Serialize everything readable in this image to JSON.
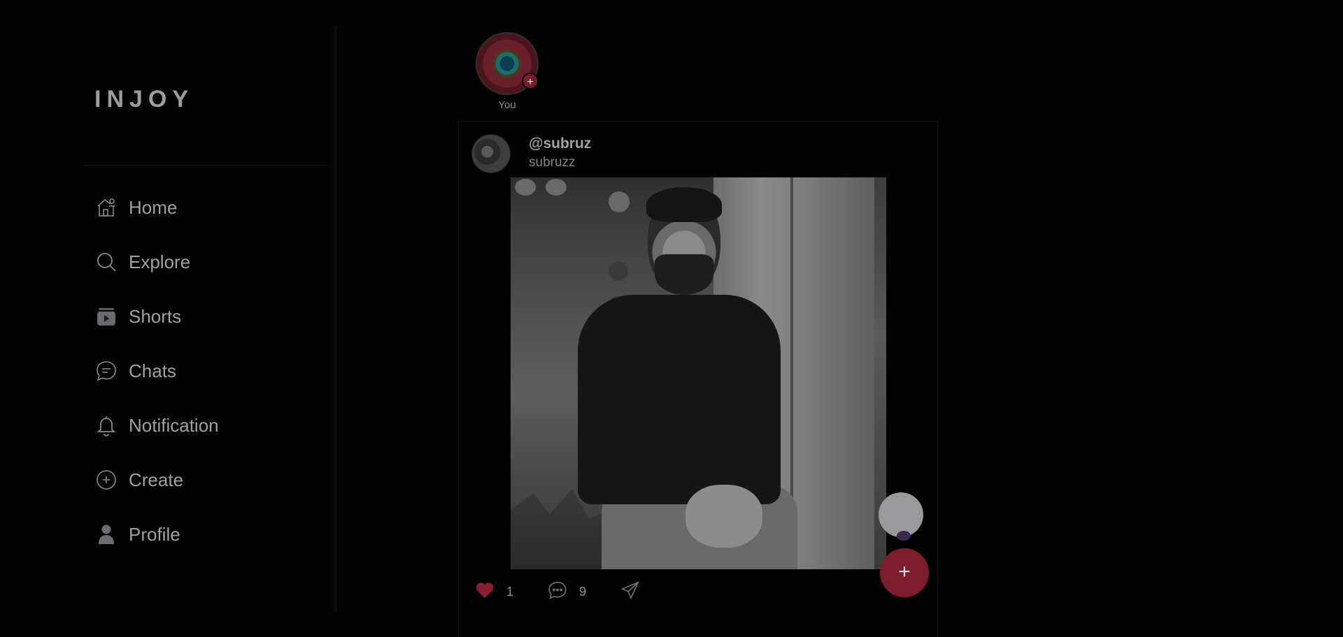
{
  "app": {
    "logo": "INJOY"
  },
  "sidebar": {
    "items": [
      {
        "label": "Home",
        "icon": "home-icon"
      },
      {
        "label": "Explore",
        "icon": "search-icon"
      },
      {
        "label": "Shorts",
        "icon": "shorts-icon"
      },
      {
        "label": "Chats",
        "icon": "chat-icon"
      },
      {
        "label": "Notification",
        "icon": "bell-icon"
      },
      {
        "label": "Create",
        "icon": "plus-circle-icon"
      },
      {
        "label": "Profile",
        "icon": "user-icon"
      }
    ]
  },
  "stories": {
    "own": {
      "label": "You",
      "add_symbol": "+"
    }
  },
  "post": {
    "handle": "@subruz",
    "name": "subruzz",
    "likes": "1",
    "comments": "9"
  },
  "fab": {
    "symbol": "+"
  },
  "colors": {
    "background": "#030304",
    "accent": "#7d1c2d",
    "text": "#a1a1a4"
  }
}
